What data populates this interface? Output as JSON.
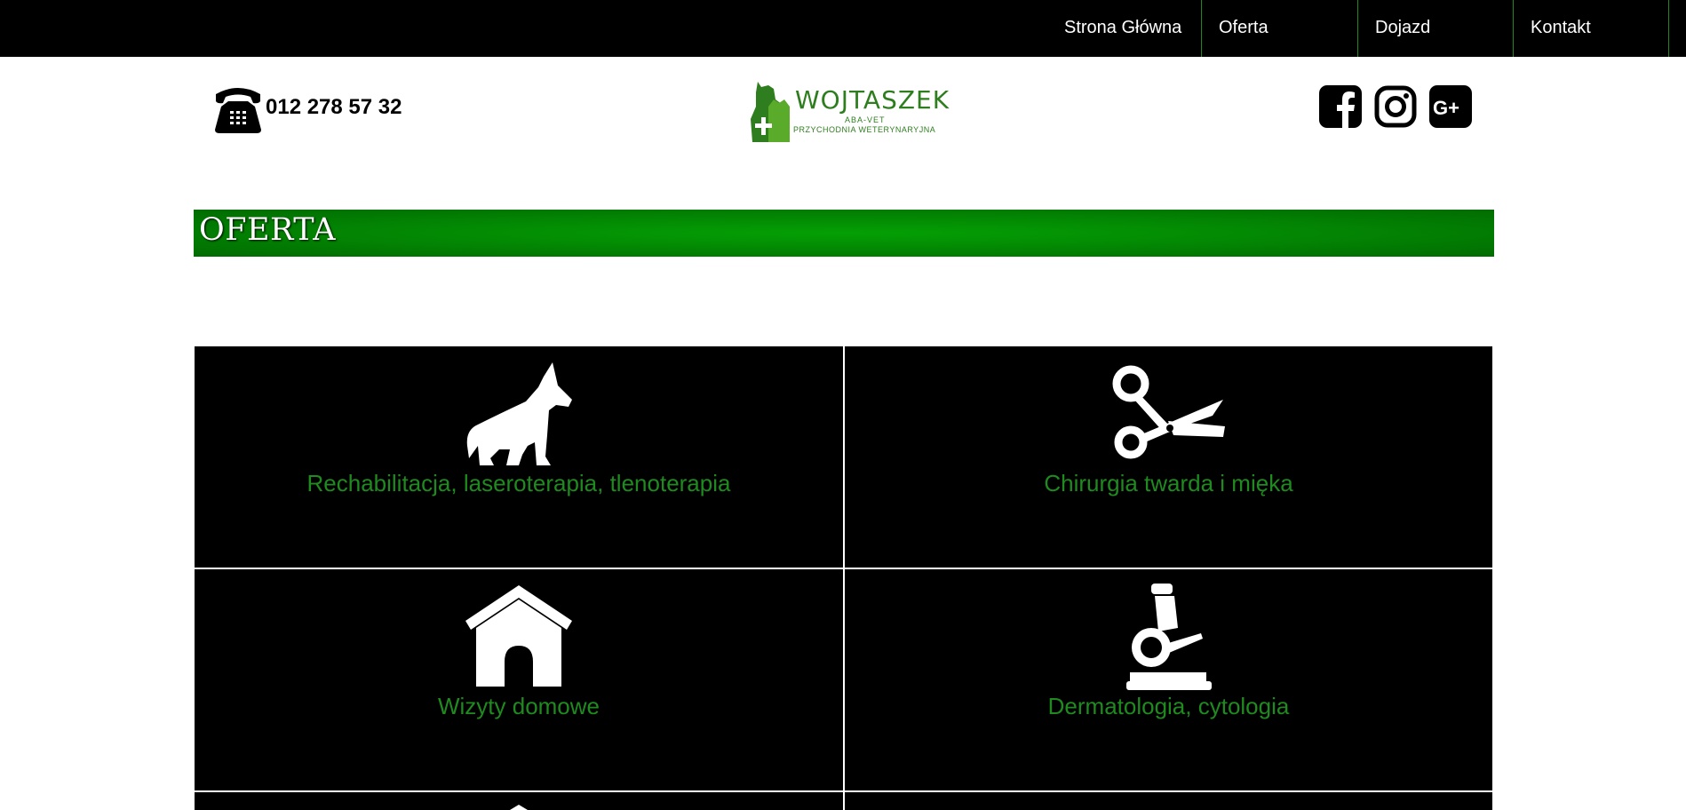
{
  "nav": {
    "items": [
      {
        "label": "Strona Główna"
      },
      {
        "label": "Oferta"
      },
      {
        "label": "Dojazd"
      },
      {
        "label": "Kontakt"
      }
    ]
  },
  "header": {
    "phone": "012 278 57 32",
    "logo": {
      "title": "WOJTASZEK",
      "subtitle1": "ABA-VET",
      "subtitle2": "PRZYCHODNIA WETERYNARYJNA"
    },
    "social": [
      "facebook-icon",
      "instagram-icon",
      "google-plus-icon"
    ]
  },
  "banner": {
    "title": "OFERTA"
  },
  "offers": [
    {
      "label": "Rechabilitacja, laseroterapia, tlenoterapia",
      "icon": "dog-icon"
    },
    {
      "label": "Chirurgia twarda i mięka",
      "icon": "scissors-icon"
    },
    {
      "label": "Wizyty domowe",
      "icon": "dog-house-icon"
    },
    {
      "label": "Dermatologia, cytologia",
      "icon": "microscope-icon"
    }
  ],
  "colors": {
    "accent": "#1f8a1f",
    "nav_bg": "#000000",
    "banner": "#038c03"
  }
}
